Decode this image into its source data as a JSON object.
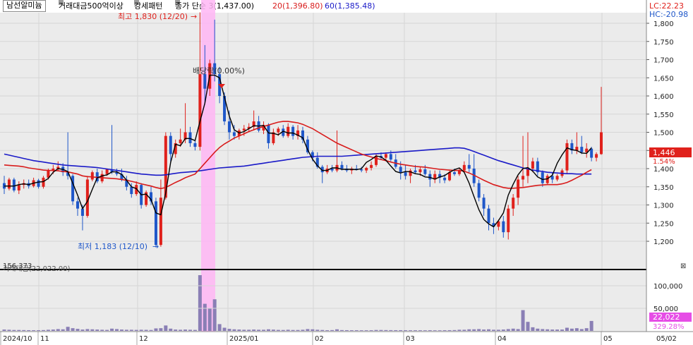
{
  "legend": {
    "stock_name": "남선알미늄",
    "condition_1": "거래대금500억이상",
    "condition_2": "강세패턴",
    "close_ma": "종가 단순 3(1,437.00)",
    "ma20": "20(1,396.80)",
    "ma60": "60(1,385.48)"
  },
  "right_indicators": {
    "lc": "LC:22.23",
    "hc": "HC:-20.98",
    "current_price": "1,446",
    "current_pct": "1.54%",
    "volume_current": "22,022",
    "volume_pct": "329.28%"
  },
  "annotations": {
    "high_label": "최고 1,830 (12/20)",
    "low_label": "최저 1,183 (12/10)",
    "ex_rights": "배당락(0.00%)"
  },
  "volume_panel": {
    "legend": "거래대금(22,022.00)",
    "scale_marker": "156,373"
  },
  "price_axis": [
    "1,800",
    "1,750",
    "1,700",
    "1,650",
    "1,600",
    "1,550",
    "1,500",
    "1,450",
    "1,400",
    "1,350",
    "1,300",
    "1,250",
    "1,200"
  ],
  "volume_axis": [
    "100,000",
    "50,000"
  ],
  "x_axis": [
    "2024/10",
    "11",
    "12",
    "2025/01",
    "02",
    "03",
    "04",
    "05",
    "05/02"
  ],
  "colors": {
    "up": "#e0211c",
    "down": "#1f57c9",
    "ma3": "#000000",
    "ma20": "#d81b1b",
    "ma60": "#1a1ac8",
    "highlight": "#ffb6f5",
    "volume": "#8a7fb5",
    "bg": "#ebebeb"
  },
  "chart_data": {
    "type": "candlestick",
    "price_ylim": [
      1150,
      1840
    ],
    "volume_ylim": [
      0,
      140000
    ],
    "candles": [
      {
        "o": 1360,
        "h": 1380,
        "l": 1330,
        "c": 1345
      },
      {
        "o": 1345,
        "h": 1375,
        "l": 1340,
        "c": 1370
      },
      {
        "o": 1370,
        "h": 1375,
        "l": 1335,
        "c": 1340
      },
      {
        "o": 1340,
        "h": 1365,
        "l": 1330,
        "c": 1355
      },
      {
        "o": 1355,
        "h": 1370,
        "l": 1345,
        "c": 1360
      },
      {
        "o": 1360,
        "h": 1370,
        "l": 1345,
        "c": 1352
      },
      {
        "o": 1352,
        "h": 1375,
        "l": 1348,
        "c": 1368
      },
      {
        "o": 1368,
        "h": 1372,
        "l": 1345,
        "c": 1350
      },
      {
        "o": 1350,
        "h": 1380,
        "l": 1345,
        "c": 1375
      },
      {
        "o": 1375,
        "h": 1400,
        "l": 1370,
        "c": 1395
      },
      {
        "o": 1395,
        "h": 1410,
        "l": 1385,
        "c": 1400
      },
      {
        "o": 1400,
        "h": 1420,
        "l": 1395,
        "c": 1405
      },
      {
        "o": 1405,
        "h": 1415,
        "l": 1380,
        "c": 1390
      },
      {
        "o": 1390,
        "h": 1500,
        "l": 1370,
        "c": 1380
      },
      {
        "o": 1380,
        "h": 1385,
        "l": 1300,
        "c": 1310
      },
      {
        "o": 1310,
        "h": 1320,
        "l": 1270,
        "c": 1290
      },
      {
        "o": 1290,
        "h": 1300,
        "l": 1230,
        "c": 1270
      },
      {
        "o": 1270,
        "h": 1380,
        "l": 1265,
        "c": 1370
      },
      {
        "o": 1370,
        "h": 1395,
        "l": 1365,
        "c": 1390
      },
      {
        "o": 1390,
        "h": 1400,
        "l": 1360,
        "c": 1365
      },
      {
        "o": 1365,
        "h": 1395,
        "l": 1360,
        "c": 1385
      },
      {
        "o": 1385,
        "h": 1400,
        "l": 1380,
        "c": 1398
      },
      {
        "o": 1398,
        "h": 1520,
        "l": 1385,
        "c": 1390
      },
      {
        "o": 1390,
        "h": 1400,
        "l": 1380,
        "c": 1385
      },
      {
        "o": 1385,
        "h": 1400,
        "l": 1365,
        "c": 1370
      },
      {
        "o": 1370,
        "h": 1380,
        "l": 1340,
        "c": 1350
      },
      {
        "o": 1350,
        "h": 1360,
        "l": 1320,
        "c": 1330
      },
      {
        "o": 1330,
        "h": 1365,
        "l": 1325,
        "c": 1355
      },
      {
        "o": 1355,
        "h": 1360,
        "l": 1290,
        "c": 1300
      },
      {
        "o": 1300,
        "h": 1340,
        "l": 1295,
        "c": 1335
      },
      {
        "o": 1335,
        "h": 1350,
        "l": 1300,
        "c": 1310
      },
      {
        "o": 1310,
        "h": 1320,
        "l": 1183,
        "c": 1190
      },
      {
        "o": 1190,
        "h": 1370,
        "l": 1185,
        "c": 1320
      },
      {
        "o": 1320,
        "h": 1500,
        "l": 1315,
        "c": 1490
      },
      {
        "o": 1490,
        "h": 1500,
        "l": 1420,
        "c": 1440
      },
      {
        "o": 1440,
        "h": 1480,
        "l": 1430,
        "c": 1470
      },
      {
        "o": 1470,
        "h": 1510,
        "l": 1460,
        "c": 1480
      },
      {
        "o": 1480,
        "h": 1580,
        "l": 1470,
        "c": 1500
      },
      {
        "o": 1500,
        "h": 1515,
        "l": 1460,
        "c": 1470
      },
      {
        "o": 1470,
        "h": 1480,
        "l": 1450,
        "c": 1460
      },
      {
        "o": 1460,
        "h": 1830,
        "l": 1450,
        "c": 1660
      },
      {
        "o": 1660,
        "h": 1740,
        "l": 1580,
        "c": 1620
      },
      {
        "o": 1620,
        "h": 1700,
        "l": 1600,
        "c": 1690
      },
      {
        "o": 1690,
        "h": 1810,
        "l": 1640,
        "c": 1660
      },
      {
        "o": 1660,
        "h": 1680,
        "l": 1580,
        "c": 1600
      },
      {
        "o": 1600,
        "h": 1610,
        "l": 1520,
        "c": 1530
      },
      {
        "o": 1530,
        "h": 1560,
        "l": 1480,
        "c": 1500
      },
      {
        "o": 1500,
        "h": 1520,
        "l": 1480,
        "c": 1490
      },
      {
        "o": 1490,
        "h": 1510,
        "l": 1480,
        "c": 1505
      },
      {
        "o": 1505,
        "h": 1520,
        "l": 1490,
        "c": 1510
      },
      {
        "o": 1510,
        "h": 1525,
        "l": 1500,
        "c": 1515
      },
      {
        "o": 1515,
        "h": 1560,
        "l": 1505,
        "c": 1530
      },
      {
        "o": 1530,
        "h": 1545,
        "l": 1500,
        "c": 1505
      },
      {
        "o": 1505,
        "h": 1530,
        "l": 1495,
        "c": 1520
      },
      {
        "o": 1520,
        "h": 1525,
        "l": 1455,
        "c": 1470
      },
      {
        "o": 1470,
        "h": 1510,
        "l": 1465,
        "c": 1500
      },
      {
        "o": 1500,
        "h": 1515,
        "l": 1490,
        "c": 1510
      },
      {
        "o": 1510,
        "h": 1520,
        "l": 1485,
        "c": 1490
      },
      {
        "o": 1490,
        "h": 1525,
        "l": 1485,
        "c": 1515
      },
      {
        "o": 1515,
        "h": 1520,
        "l": 1480,
        "c": 1490
      },
      {
        "o": 1490,
        "h": 1520,
        "l": 1480,
        "c": 1505
      },
      {
        "o": 1505,
        "h": 1515,
        "l": 1470,
        "c": 1480
      },
      {
        "o": 1480,
        "h": 1490,
        "l": 1440,
        "c": 1445
      },
      {
        "o": 1445,
        "h": 1450,
        "l": 1420,
        "c": 1430
      },
      {
        "o": 1430,
        "h": 1445,
        "l": 1400,
        "c": 1405
      },
      {
        "o": 1405,
        "h": 1410,
        "l": 1360,
        "c": 1390
      },
      {
        "o": 1390,
        "h": 1410,
        "l": 1385,
        "c": 1400
      },
      {
        "o": 1400,
        "h": 1410,
        "l": 1390,
        "c": 1395
      },
      {
        "o": 1395,
        "h": 1505,
        "l": 1390,
        "c": 1410
      },
      {
        "o": 1410,
        "h": 1420,
        "l": 1395,
        "c": 1400
      },
      {
        "o": 1400,
        "h": 1410,
        "l": 1390,
        "c": 1395
      },
      {
        "o": 1395,
        "h": 1405,
        "l": 1385,
        "c": 1400
      },
      {
        "o": 1400,
        "h": 1410,
        "l": 1395,
        "c": 1398
      },
      {
        "o": 1398,
        "h": 1405,
        "l": 1390,
        "c": 1395
      },
      {
        "o": 1395,
        "h": 1405,
        "l": 1388,
        "c": 1402
      },
      {
        "o": 1402,
        "h": 1420,
        "l": 1395,
        "c": 1410
      },
      {
        "o": 1410,
        "h": 1440,
        "l": 1405,
        "c": 1435
      },
      {
        "o": 1435,
        "h": 1445,
        "l": 1425,
        "c": 1430
      },
      {
        "o": 1430,
        "h": 1445,
        "l": 1420,
        "c": 1440
      },
      {
        "o": 1440,
        "h": 1450,
        "l": 1420,
        "c": 1425
      },
      {
        "o": 1425,
        "h": 1440,
        "l": 1400,
        "c": 1405
      },
      {
        "o": 1405,
        "h": 1420,
        "l": 1370,
        "c": 1390
      },
      {
        "o": 1390,
        "h": 1410,
        "l": 1370,
        "c": 1380
      },
      {
        "o": 1380,
        "h": 1400,
        "l": 1360,
        "c": 1395
      },
      {
        "o": 1395,
        "h": 1410,
        "l": 1385,
        "c": 1390
      },
      {
        "o": 1390,
        "h": 1405,
        "l": 1380,
        "c": 1398
      },
      {
        "o": 1398,
        "h": 1410,
        "l": 1380,
        "c": 1385
      },
      {
        "o": 1385,
        "h": 1395,
        "l": 1350,
        "c": 1370
      },
      {
        "o": 1370,
        "h": 1395,
        "l": 1360,
        "c": 1385
      },
      {
        "o": 1385,
        "h": 1395,
        "l": 1360,
        "c": 1375
      },
      {
        "o": 1375,
        "h": 1385,
        "l": 1360,
        "c": 1368
      },
      {
        "o": 1368,
        "h": 1395,
        "l": 1365,
        "c": 1390
      },
      {
        "o": 1390,
        "h": 1400,
        "l": 1380,
        "c": 1385
      },
      {
        "o": 1385,
        "h": 1400,
        "l": 1380,
        "c": 1395
      },
      {
        "o": 1395,
        "h": 1420,
        "l": 1390,
        "c": 1410
      },
      {
        "o": 1410,
        "h": 1440,
        "l": 1390,
        "c": 1400
      },
      {
        "o": 1400,
        "h": 1440,
        "l": 1350,
        "c": 1360
      },
      {
        "o": 1360,
        "h": 1370,
        "l": 1310,
        "c": 1320
      },
      {
        "o": 1320,
        "h": 1330,
        "l": 1270,
        "c": 1290
      },
      {
        "o": 1290,
        "h": 1300,
        "l": 1230,
        "c": 1250
      },
      {
        "o": 1250,
        "h": 1265,
        "l": 1220,
        "c": 1240
      },
      {
        "o": 1240,
        "h": 1260,
        "l": 1230,
        "c": 1255
      },
      {
        "o": 1255,
        "h": 1270,
        "l": 1210,
        "c": 1225
      },
      {
        "o": 1225,
        "h": 1300,
        "l": 1205,
        "c": 1290
      },
      {
        "o": 1290,
        "h": 1330,
        "l": 1270,
        "c": 1320
      },
      {
        "o": 1320,
        "h": 1380,
        "l": 1300,
        "c": 1370
      },
      {
        "o": 1370,
        "h": 1490,
        "l": 1350,
        "c": 1380
      },
      {
        "o": 1380,
        "h": 1500,
        "l": 1360,
        "c": 1400
      },
      {
        "o": 1400,
        "h": 1430,
        "l": 1390,
        "c": 1420
      },
      {
        "o": 1420,
        "h": 1430,
        "l": 1380,
        "c": 1390
      },
      {
        "o": 1390,
        "h": 1395,
        "l": 1350,
        "c": 1360
      },
      {
        "o": 1360,
        "h": 1385,
        "l": 1355,
        "c": 1380
      },
      {
        "o": 1380,
        "h": 1390,
        "l": 1360,
        "c": 1370
      },
      {
        "o": 1370,
        "h": 1385,
        "l": 1365,
        "c": 1380
      },
      {
        "o": 1380,
        "h": 1400,
        "l": 1375,
        "c": 1395
      },
      {
        "o": 1395,
        "h": 1480,
        "l": 1385,
        "c": 1470
      },
      {
        "o": 1470,
        "h": 1480,
        "l": 1440,
        "c": 1450
      },
      {
        "o": 1450,
        "h": 1500,
        "l": 1440,
        "c": 1460
      },
      {
        "o": 1460,
        "h": 1490,
        "l": 1440,
        "c": 1445
      },
      {
        "o": 1445,
        "h": 1470,
        "l": 1430,
        "c": 1455
      },
      {
        "o": 1455,
        "h": 1460,
        "l": 1420,
        "c": 1430
      },
      {
        "o": 1430,
        "h": 1445,
        "l": 1420,
        "c": 1440
      },
      {
        "o": 1440,
        "h": 1625,
        "l": 1438,
        "c": 1500
      }
    ],
    "ma3": [
      1352,
      1352,
      1352,
      1356,
      1358,
      1356,
      1360,
      1363,
      1364,
      1373,
      1390,
      1400,
      1398,
      1392,
      1360,
      1327,
      1290,
      1310,
      1343,
      1375,
      1380,
      1383,
      1391,
      1391,
      1384,
      1368,
      1350,
      1345,
      1328,
      1330,
      1315,
      1278,
      1273,
      1333,
      1417,
      1467,
      1463,
      1483,
      1483,
      1477,
      1530,
      1580,
      1657,
      1657,
      1650,
      1597,
      1544,
      1507,
      1498,
      1502,
      1510,
      1518,
      1517,
      1519,
      1498,
      1497,
      1493,
      1503,
      1498,
      1498,
      1492,
      1485,
      1452,
      1426,
      1408,
      1395,
      1395,
      1402,
      1402,
      1398,
      1398,
      1398,
      1397,
      1400,
      1417,
      1425,
      1435,
      1432,
      1423,
      1407,
      1392,
      1388,
      1392,
      1391,
      1386,
      1384,
      1377,
      1376,
      1371,
      1377,
      1381,
      1390,
      1397,
      1402,
      1390,
      1360,
      1323,
      1287,
      1260,
      1248,
      1240,
      1257,
      1278,
      1327,
      1357,
      1383,
      1400,
      1403,
      1393,
      1377,
      1370,
      1372,
      1382,
      1415,
      1438,
      1457,
      1452,
      1450,
      1443,
      1442,
      1457
    ],
    "ma20": [
      1410,
      1409,
      1408,
      1407,
      1405,
      1402,
      1400,
      1398,
      1396,
      1395,
      1395,
      1394,
      1392,
      1391,
      1388,
      1385,
      1380,
      1378,
      1377,
      1376,
      1375,
      1374,
      1373,
      1372,
      1370,
      1368,
      1365,
      1362,
      1358,
      1355,
      1352,
      1348,
      1345,
      1348,
      1355,
      1362,
      1368,
      1375,
      1380,
      1385,
      1400,
      1415,
      1430,
      1445,
      1458,
      1468,
      1476,
      1484,
      1490,
      1496,
      1502,
      1507,
      1512,
      1516,
      1520,
      1524,
      1528,
      1530,
      1530,
      1528,
      1526,
      1522,
      1516,
      1510,
      1502,
      1494,
      1486,
      1478,
      1470,
      1464,
      1458,
      1452,
      1446,
      1440,
      1436,
      1432,
      1428,
      1425,
      1422,
      1418,
      1415,
      1412,
      1410,
      1408,
      1406,
      1405,
      1404,
      1402,
      1400,
      1398,
      1397,
      1396,
      1395,
      1395,
      1393,
      1388,
      1382,
      1375,
      1368,
      1362,
      1356,
      1352,
      1348,
      1346,
      1346,
      1347,
      1348,
      1350,
      1352,
      1354,
      1355,
      1356,
      1356,
      1356,
      1358,
      1362,
      1368,
      1375,
      1382,
      1390,
      1397
    ],
    "ma60": [
      1440,
      1437,
      1434,
      1431,
      1428,
      1425,
      1422,
      1420,
      1418,
      1416,
      1414,
      1412,
      1410,
      1409,
      1408,
      1407,
      1406,
      1405,
      1404,
      1403,
      1401,
      1399,
      1397,
      1395,
      1393,
      1391,
      1389,
      1387,
      1385,
      1384,
      1383,
      1382,
      1382,
      1383,
      1385,
      1387,
      1389,
      1390,
      1391,
      1392,
      1394,
      1396,
      1398,
      1400,
      1402,
      1403,
      1404,
      1405,
      1406,
      1407,
      1409,
      1411,
      1413,
      1415,
      1417,
      1419,
      1421,
      1423,
      1425,
      1427,
      1429,
      1431,
      1432,
      1433,
      1434,
      1434,
      1434,
      1434,
      1434,
      1434,
      1435,
      1436,
      1437,
      1438,
      1439,
      1440,
      1441,
      1442,
      1443,
      1444,
      1445,
      1446,
      1447,
      1448,
      1449,
      1450,
      1451,
      1452,
      1453,
      1454,
      1455,
      1456,
      1457,
      1457,
      1456,
      1452,
      1447,
      1442,
      1437,
      1432,
      1427,
      1422,
      1418,
      1414,
      1410,
      1406,
      1402,
      1399,
      1396,
      1394,
      1392,
      1390,
      1389,
      1388,
      1387,
      1386,
      1386,
      1385,
      1385,
      1385,
      1385
    ],
    "volume": [
      3000,
      2500,
      2000,
      2000,
      1800,
      1600,
      1500,
      1500,
      1800,
      2500,
      3000,
      4000,
      3500,
      9000,
      6000,
      4500,
      3000,
      4000,
      3500,
      3000,
      2500,
      2200,
      5000,
      4000,
      3000,
      2500,
      2500,
      2200,
      2500,
      2300,
      2000,
      5500,
      6000,
      12000,
      5000,
      3000,
      2500,
      3000,
      2500,
      2200,
      133000,
      60000,
      50000,
      70000,
      15000,
      7000,
      4500,
      3500,
      3000,
      2500,
      2500,
      3000,
      2500,
      2500,
      3500,
      2800,
      2200,
      2000,
      2500,
      2000,
      2000,
      2500,
      4000,
      3500,
      2500,
      2000,
      1500,
      1800,
      3500,
      1800,
      1600,
      1500,
      1500,
      1400,
      1400,
      1500,
      2000,
      2000,
      1800,
      1700,
      1600,
      1600,
      1500,
      1400,
      1400,
      1400,
      1300,
      1500,
      1300,
      1300,
      1500,
      1600,
      1800,
      2500,
      2500,
      3500,
      3500,
      4000,
      3000,
      3500,
      2500,
      2500,
      3000,
      4000,
      5000,
      4000,
      46000,
      20000,
      8000,
      5000,
      4000,
      3500,
      3000,
      3000,
      3000,
      7000,
      5000,
      6000,
      4000,
      6000,
      22022
    ]
  }
}
